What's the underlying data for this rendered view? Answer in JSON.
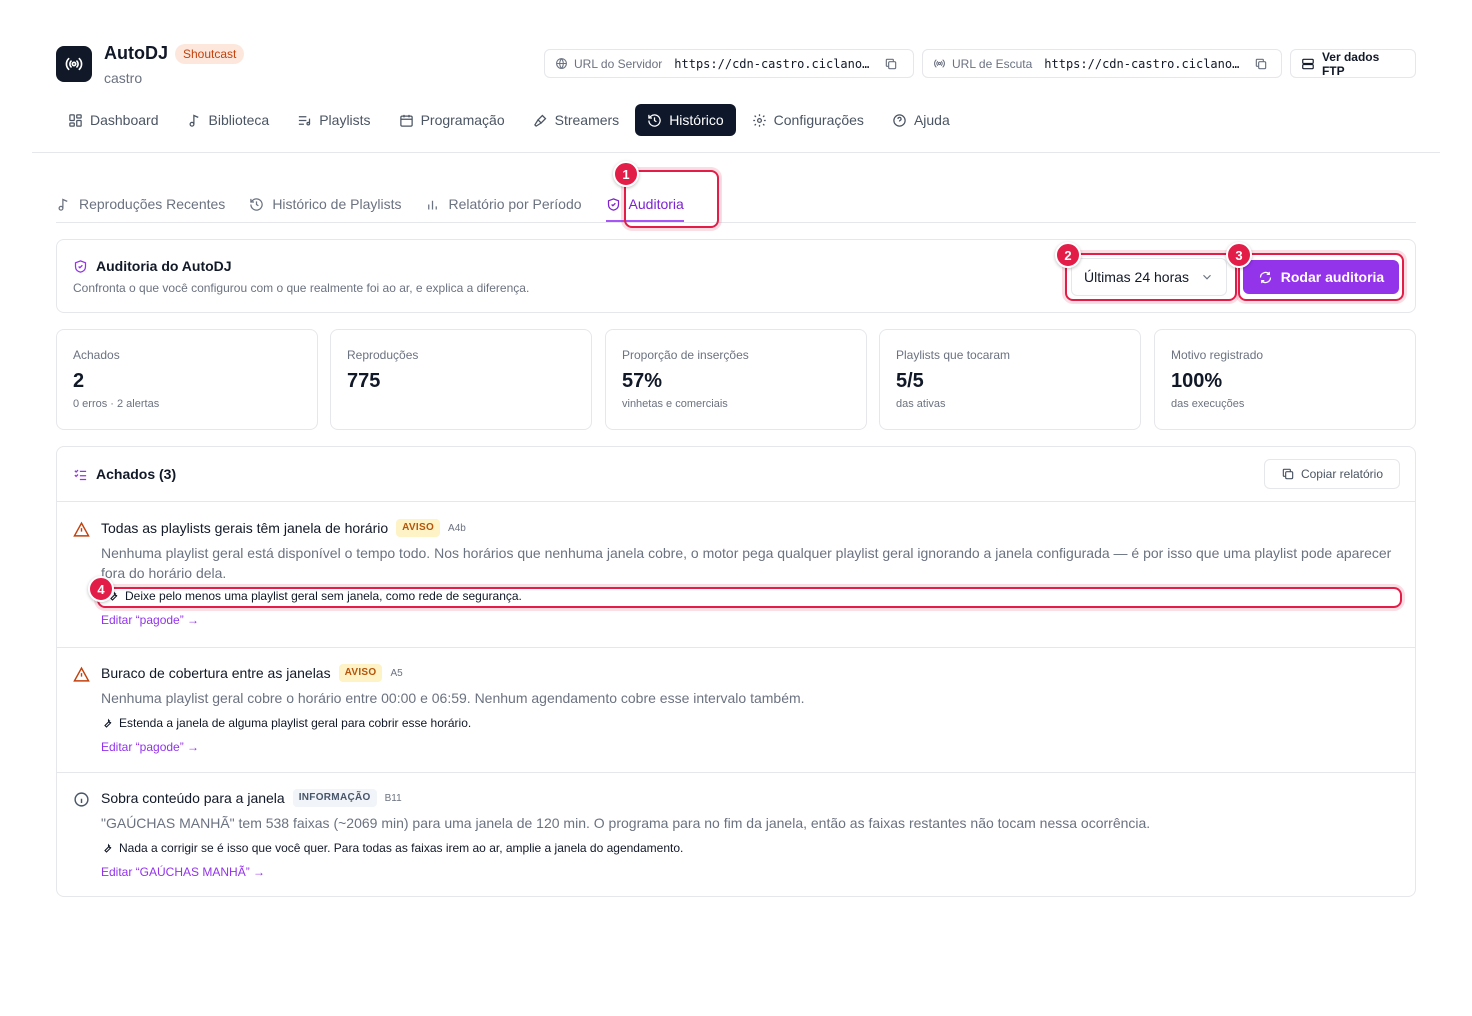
{
  "app": {
    "title": "AutoDJ",
    "badge": "Shoutcast",
    "subtitle": "castro",
    "icon": "broadcast-icon"
  },
  "header": {
    "server_url_label": "URL do Servidor",
    "server_url_value": "https://cdn-castro.ciclano…",
    "listen_url_label": "URL de Escuta",
    "listen_url_value": "https://cdn-castro.ciclano…",
    "ftp_button": "Ver dados FTP"
  },
  "nav": {
    "items": [
      {
        "label": "Dashboard",
        "icon": "dashboard-icon"
      },
      {
        "label": "Biblioteca",
        "icon": "music-note-icon"
      },
      {
        "label": "Playlists",
        "icon": "playlist-icon"
      },
      {
        "label": "Programação",
        "icon": "calendar-icon"
      },
      {
        "label": "Streamers",
        "icon": "microphone-icon"
      },
      {
        "label": "Histórico",
        "icon": "history-icon",
        "active": true
      },
      {
        "label": "Configurações",
        "icon": "gear-icon"
      },
      {
        "label": "Ajuda",
        "icon": "help-icon"
      }
    ]
  },
  "subtabs": {
    "items": [
      {
        "label": "Reproduções Recentes",
        "icon": "music-note-icon"
      },
      {
        "label": "Histórico de Playlists",
        "icon": "history-icon"
      },
      {
        "label": "Relatório por Período",
        "icon": "bar-chart-icon"
      },
      {
        "label": "Auditoria",
        "icon": "shield-icon",
        "active": true
      }
    ]
  },
  "audit": {
    "title": "Auditoria do AutoDJ",
    "description": "Confronta o que você configurou com o que realmente foi ao ar, e explica a diferença.",
    "period_value": "Últimas 24 horas",
    "run_button": "Rodar auditoria"
  },
  "stats": [
    {
      "label": "Achados",
      "value": "2",
      "note": "0 erros · 2 alertas"
    },
    {
      "label": "Reproduções",
      "value": "775",
      "note": ""
    },
    {
      "label": "Proporção de inserções",
      "value": "57%",
      "note": "vinhetas e comerciais"
    },
    {
      "label": "Playlists que tocaram",
      "value": "5/5",
      "note": "das ativas"
    },
    {
      "label": "Motivo registrado",
      "value": "100%",
      "note": "das execuções"
    }
  ],
  "findings": {
    "title": "Achados (3)",
    "copy_button": "Copiar relatório",
    "items": [
      {
        "title": "Todas as playlists gerais têm janela de horário",
        "tag": "AVISO",
        "code": "A4b",
        "severity": "warning",
        "description": "Nenhuma playlist geral está disponível o tempo todo. Nos horários que nenhuma janela cobre, o motor pega qualquer playlist geral ignorando a janela configurada — é por isso que uma playlist pode aparecer fora do horário dela.",
        "fix": "Deixe pelo menos uma playlist geral sem janela, como rede de segurança.",
        "link": "Editar “pagode” →"
      },
      {
        "title": "Buraco de cobertura entre as janelas",
        "tag": "AVISO",
        "code": "A5",
        "severity": "warning",
        "description": "Nenhuma playlist geral cobre o horário entre 00:00 e 06:59. Nenhum agendamento cobre esse intervalo também.",
        "fix": "Estenda a janela de alguma playlist geral para cobrir esse horário.",
        "link": "Editar “pagode” →"
      },
      {
        "title": "Sobra conteúdo para a janela",
        "tag": "INFORMAÇÃO",
        "code": "B11",
        "severity": "info",
        "description": "\"GAÚCHAS MANHÃ\" tem 538 faixas (~2069 min) para uma janela de 120 min. O programa para no fim da janela, então as faixas restantes não tocam nessa ocorrência.",
        "fix": "Nada a corrigir se é isso que você quer. Para todas as faixas irem ao ar, amplie a janela do agendamento.",
        "link": "Editar “GAÚCHAS MANHÃ” →"
      }
    ]
  },
  "annotations": {
    "markers": [
      "1",
      "2",
      "3",
      "4"
    ]
  },
  "colors": {
    "accent": "#9333ea",
    "annotation": "#e11d48",
    "nav_active_bg": "#0f172a",
    "warning": "#b45309"
  }
}
